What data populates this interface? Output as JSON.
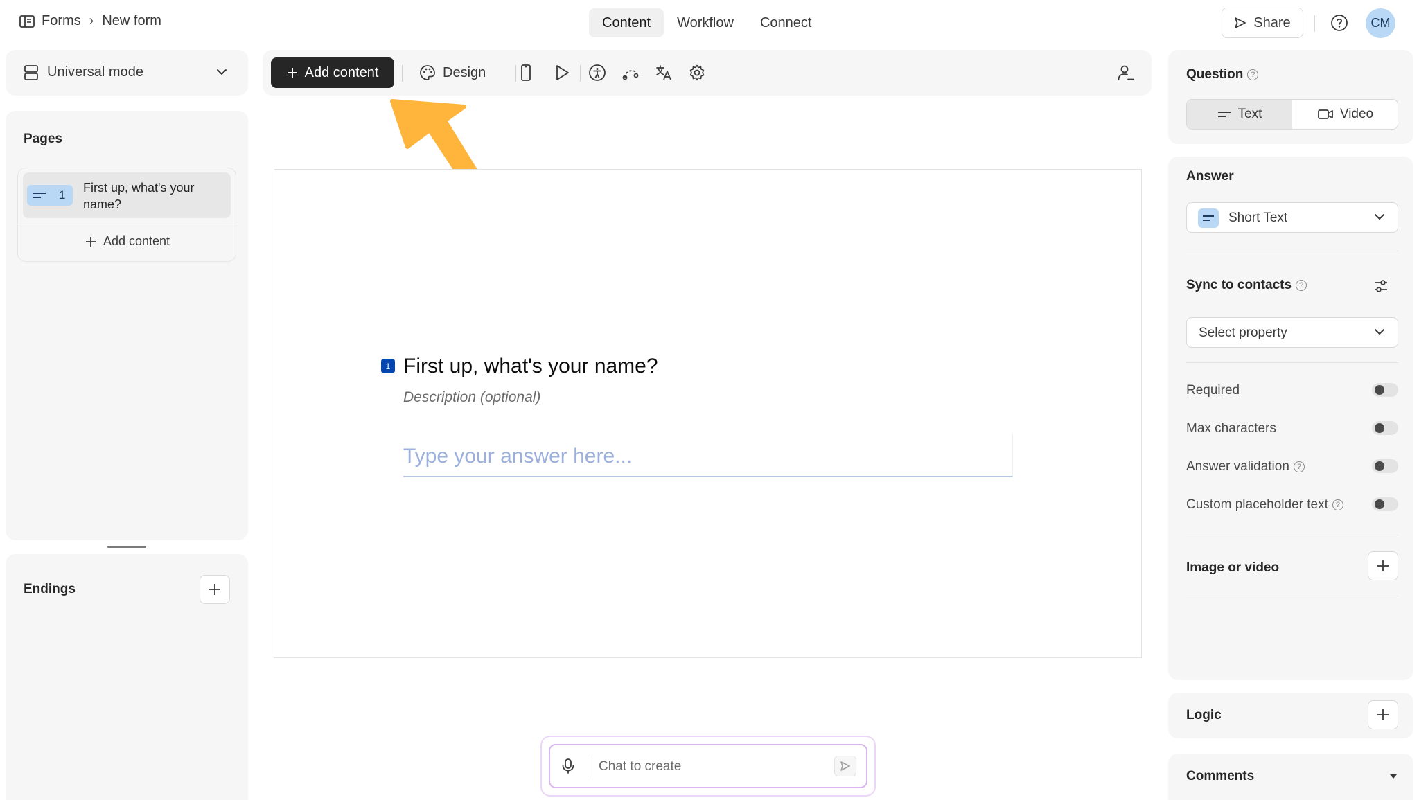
{
  "breadcrumb": {
    "root": "Forms",
    "current": "New form"
  },
  "top_tabs": [
    {
      "label": "Content",
      "active": true
    },
    {
      "label": "Workflow",
      "active": false
    },
    {
      "label": "Connect",
      "active": false
    }
  ],
  "share_label": "Share",
  "avatar_initials": "CM",
  "mode_label": "Universal mode",
  "pages": {
    "title": "Pages",
    "items": [
      {
        "number": "1",
        "title": "First up, what's your name?"
      }
    ],
    "add_label": "Add content"
  },
  "endings_title": "Endings",
  "toolbar": {
    "add_label": "Add content",
    "design_label": "Design"
  },
  "question": {
    "number": "1",
    "title": "First up, what's your name?",
    "description": "Description (optional)",
    "placeholder": "Type your answer here..."
  },
  "chat": {
    "placeholder": "Chat to create"
  },
  "right_panel": {
    "question_title": "Question",
    "segments": [
      {
        "label": "Text",
        "active": true
      },
      {
        "label": "Video",
        "active": false
      }
    ],
    "answer_title": "Answer",
    "answer_type": "Short Text",
    "sync_title": "Sync to contacts",
    "sync_select": "Select property",
    "toggles": [
      {
        "label": "Required",
        "help": false,
        "on": false
      },
      {
        "label": "Max characters",
        "help": false,
        "on": false
      },
      {
        "label": "Answer validation",
        "help": true,
        "on": false
      },
      {
        "label": "Custom placeholder text",
        "help": true,
        "on": false
      }
    ],
    "image_title": "Image or video",
    "logic_title": "Logic",
    "comments_title": "Comments"
  },
  "colors": {
    "accent_arrow": "#ffb43c",
    "question_badge": "#0445af",
    "placeholder": "#9cb0de",
    "chip_blue": "#b8d8f6"
  }
}
